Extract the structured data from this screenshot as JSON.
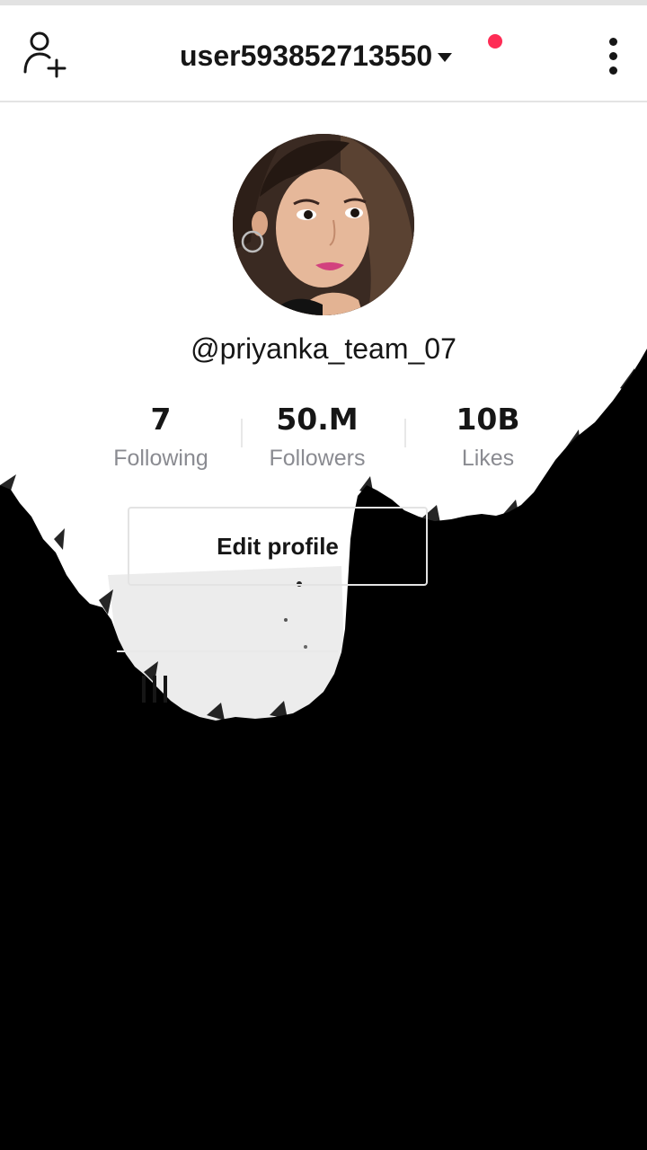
{
  "header": {
    "account_name": "user593852713550",
    "icons": {
      "add_user": "add-user-icon",
      "caret": "caret-down-icon",
      "notification": "notification-dot",
      "more": "more-vertical-icon"
    },
    "notification_color": "#fe2c55"
  },
  "profile": {
    "username": "@priyanka_team_07",
    "avatar": "profile-photo"
  },
  "stats": [
    {
      "value": "7",
      "label": "Following"
    },
    {
      "value": "50.M",
      "label": "Followers"
    },
    {
      "value": "10B",
      "label": "Likes"
    }
  ],
  "actions": {
    "edit_profile_label": "Edit profile"
  },
  "tabs": {
    "videos_icon": "video-grid-icon"
  },
  "colors": {
    "text_primary": "#161616",
    "text_secondary": "#8a8b91",
    "ink_overlay": "#000000",
    "accent": "#fe2c55"
  }
}
